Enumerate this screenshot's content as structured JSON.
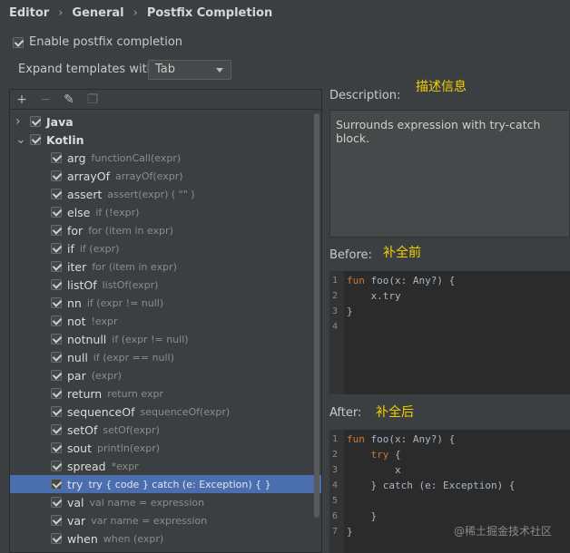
{
  "breadcrumb": [
    "Editor",
    "General",
    "Postfix Completion"
  ],
  "enable_label": "Enable postfix completion",
  "expand_label": "Expand templates with",
  "expand_value": "Tab",
  "description_label": "Description:",
  "description_annotation": "描述信息",
  "description_text": "Surrounds expression with try-catch block.",
  "before_label": "Before:",
  "before_annotation": "补全前",
  "after_label": "After:",
  "after_annotation": "补全后",
  "watermark": "@稀土掘金技术社区",
  "tree": {
    "groups": [
      {
        "name": "Java",
        "expanded": false
      },
      {
        "name": "Kotlin",
        "expanded": true
      }
    ],
    "items": [
      {
        "key": "arg",
        "example": "functionCall(expr)"
      },
      {
        "key": "arrayOf",
        "example": "arrayOf(expr)"
      },
      {
        "key": "assert",
        "example": "assert(expr) ( \"\" )"
      },
      {
        "key": "else",
        "example": "if (!expr)"
      },
      {
        "key": "for",
        "example": "for (item in expr)"
      },
      {
        "key": "if",
        "example": "if (expr)"
      },
      {
        "key": "iter",
        "example": "for (item in expr)"
      },
      {
        "key": "listOf",
        "example": "listOf(expr)"
      },
      {
        "key": "nn",
        "example": "if (expr != null)"
      },
      {
        "key": "not",
        "example": "!expr"
      },
      {
        "key": "notnull",
        "example": "if (expr != null)"
      },
      {
        "key": "null",
        "example": "if (expr == null)"
      },
      {
        "key": "par",
        "example": "(expr)"
      },
      {
        "key": "return",
        "example": "return expr"
      },
      {
        "key": "sequenceOf",
        "example": "sequenceOf(expr)"
      },
      {
        "key": "setOf",
        "example": "setOf(expr)"
      },
      {
        "key": "sout",
        "example": "println(expr)"
      },
      {
        "key": "spread",
        "example": "*expr"
      },
      {
        "key": "try",
        "example": "try { code } catch (e: Exception) { }",
        "selected": true
      },
      {
        "key": "val",
        "example": "val name = expression"
      },
      {
        "key": "var",
        "example": "var name = expression"
      },
      {
        "key": "when",
        "example": "when (expr)"
      }
    ]
  },
  "before_code": [
    {
      "n": "1",
      "kw": "fun",
      "rest": " foo(x: Any?) {"
    },
    {
      "n": "2",
      "kw": "",
      "rest": "    x.try"
    },
    {
      "n": "3",
      "kw": "",
      "rest": "}"
    },
    {
      "n": "4",
      "kw": "",
      "rest": ""
    }
  ],
  "after_code": [
    {
      "n": "1",
      "kw": "fun",
      "rest": " foo(x: Any?) {"
    },
    {
      "n": "2",
      "kw": "try",
      "pre": "    ",
      "rest": " {"
    },
    {
      "n": "3",
      "kw": "",
      "rest": "        x"
    },
    {
      "n": "4",
      "kw": "",
      "rest": "    } catch (e: Exception) {"
    },
    {
      "n": "5",
      "kw": "",
      "rest": ""
    },
    {
      "n": "6",
      "kw": "",
      "rest": "    }"
    },
    {
      "n": "7",
      "kw": "",
      "rest": "}"
    }
  ]
}
